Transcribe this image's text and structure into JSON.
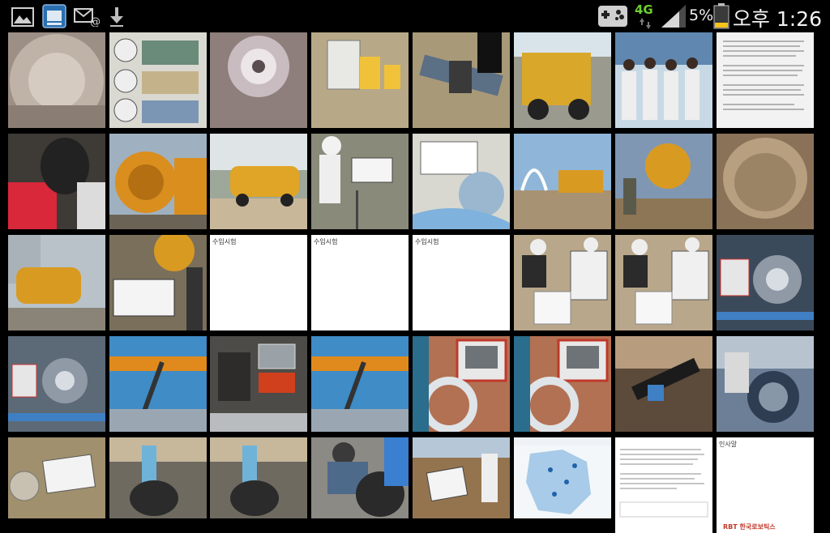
{
  "status_bar": {
    "time": "오후 1:26",
    "battery_percent": "5%",
    "network_type": "4G",
    "notification_icons": [
      "gallery-icon",
      "screenshot-icon",
      "email-icon",
      "download-icon"
    ],
    "system_icons": [
      "gamepad-icon",
      "signal-icon",
      "battery-icon"
    ]
  },
  "gallery": {
    "thumbnails": [
      {
        "id": "r1c1",
        "bg": "#9c8f85"
      },
      {
        "id": "r1c2",
        "bg": "#cfcfc7"
      },
      {
        "id": "r1c3",
        "bg": "#8e7f7c"
      },
      {
        "id": "r1c4",
        "bg": "#b7a988"
      },
      {
        "id": "r1c5",
        "bg": "#a89978"
      },
      {
        "id": "r1c6",
        "bg": "#c3a24a"
      },
      {
        "id": "r1c7",
        "bg": "#9db8cc"
      },
      {
        "id": "r1c8",
        "bg": "#f0f0f0"
      },
      {
        "id": "r2c1",
        "bg": "#3e3a36"
      },
      {
        "id": "r2c2",
        "bg": "#b0822c"
      },
      {
        "id": "r2c3",
        "bg": "#8c8a67"
      },
      {
        "id": "r2c4",
        "bg": "#8a8a7a"
      },
      {
        "id": "r2c5",
        "bg": "#d8d8d0"
      },
      {
        "id": "r2c6",
        "bg": "#8fb6d8"
      },
      {
        "id": "r2c7",
        "bg": "#7f97b3"
      },
      {
        "id": "r2c8",
        "bg": "#8a7258"
      },
      {
        "id": "r3c1",
        "bg": "#8e8a7f"
      },
      {
        "id": "r3c2",
        "bg": "#7a6f5b"
      },
      {
        "id": "r3c3",
        "bg": "#ffffff"
      },
      {
        "id": "r3c4",
        "bg": "#ffffff"
      },
      {
        "id": "r3c5",
        "bg": "#ffffff"
      },
      {
        "id": "r3c6",
        "bg": "#b8a78a"
      },
      {
        "id": "r3c7",
        "bg": "#b8a78a"
      },
      {
        "id": "r3c8",
        "bg": "#3b4a5a"
      },
      {
        "id": "r4c1",
        "bg": "#5c6a77"
      },
      {
        "id": "r4c2",
        "bg": "#3f8cc6"
      },
      {
        "id": "r4c3",
        "bg": "#4d4b47"
      },
      {
        "id": "r4c4",
        "bg": "#3f8cc6"
      },
      {
        "id": "r4c5",
        "bg": "#b27153"
      },
      {
        "id": "r4c6",
        "bg": "#b27153"
      },
      {
        "id": "r4c7",
        "bg": "#5c4a3a"
      },
      {
        "id": "r4c8",
        "bg": "#6d7f96"
      },
      {
        "id": "r5c1",
        "bg": "#a0906e"
      },
      {
        "id": "r5c2",
        "bg": "#6e6a60"
      },
      {
        "id": "r5c3",
        "bg": "#6e6a60"
      },
      {
        "id": "r5c4",
        "bg": "#8c8a84"
      },
      {
        "id": "r5c5",
        "bg": "#94744f"
      },
      {
        "id": "r5c6",
        "bg": "#dfe9f2"
      },
      {
        "id": "r5c7",
        "bg": "#ffffff"
      },
      {
        "id": "r5c8",
        "bg": "#ffffff"
      }
    ],
    "document_captions": {
      "r3c3": "수입시험",
      "r3c4": "수입시험",
      "r3c5": "수입시험",
      "r5c8": "인사말"
    },
    "r5c8_logo": "RBT 한국로보틱스"
  }
}
